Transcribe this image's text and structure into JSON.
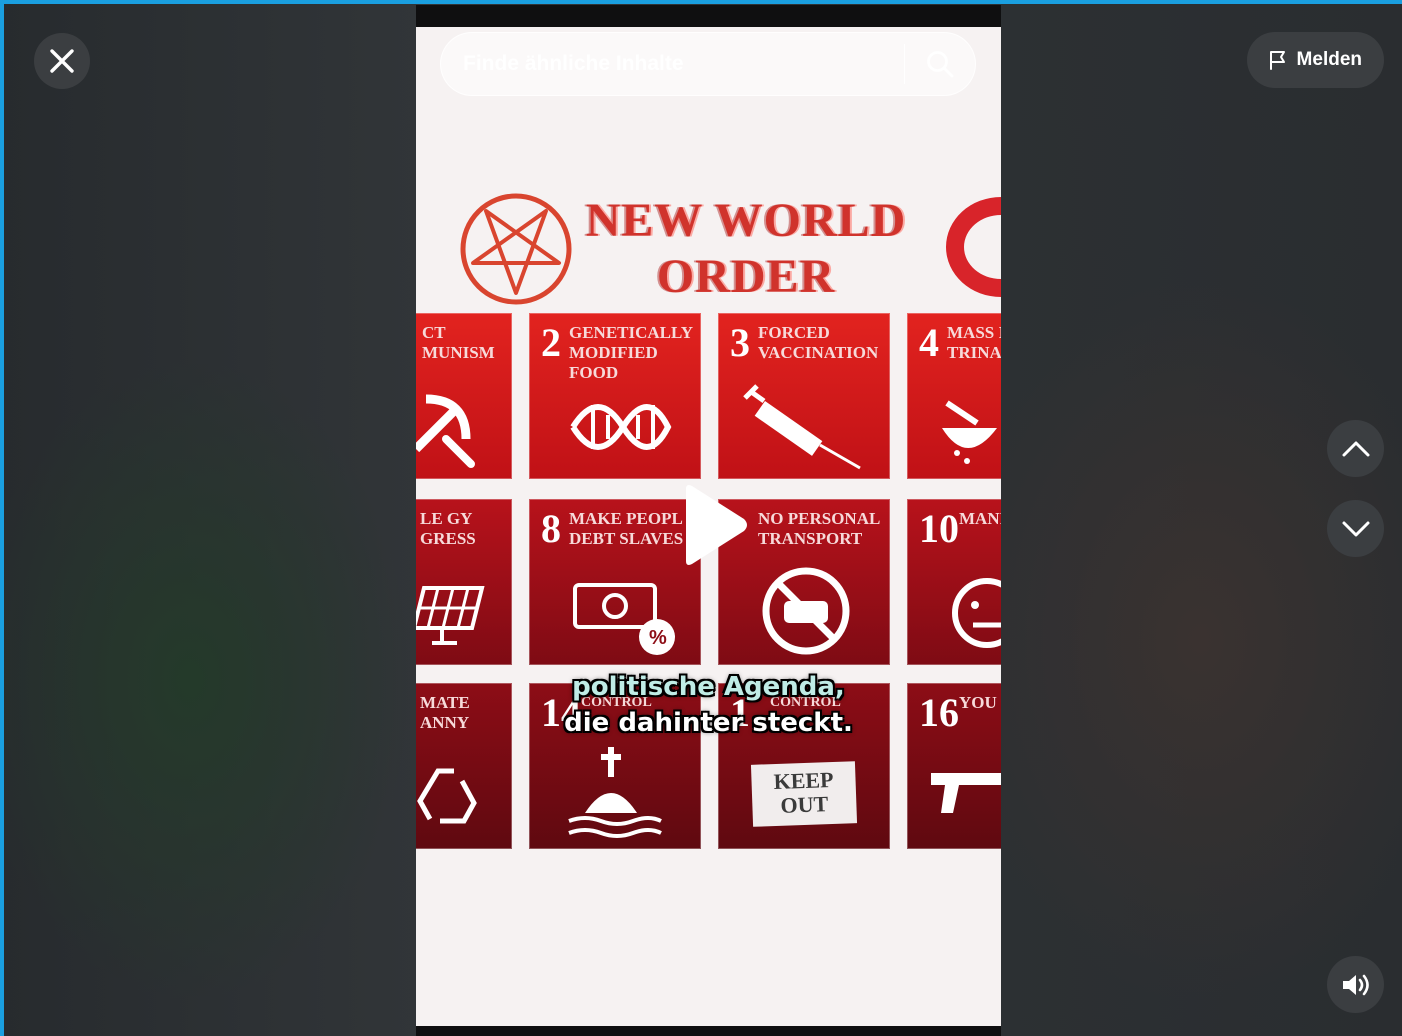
{
  "overlay": {
    "report_label": "Melden",
    "close_icon": "close-icon",
    "report_icon": "flag-icon",
    "prev_icon": "chevron-up-icon",
    "next_icon": "chevron-down-icon",
    "sound_icon": "speaker-icon"
  },
  "search": {
    "placeholder": "Finde ähnliche Inhalte",
    "value": ""
  },
  "video": {
    "poster_title_line1": "NEW WORLD",
    "poster_title_line2": "ORDER",
    "tiles": [
      {
        "num": "",
        "text": "CT MUNISM"
      },
      {
        "num": "2",
        "text": "GENETICALLY MODIFIED FOOD"
      },
      {
        "num": "3",
        "text": "FORCED VACCINATION"
      },
      {
        "num": "4",
        "text": "MASS INDO TRINA"
      },
      {
        "num": "",
        "text": "LE GY GRESS"
      },
      {
        "num": "8",
        "text": "MAKE PEOPL DEBT SLAVES"
      },
      {
        "num": "",
        "text": "NO PERSONAL TRANSPORT"
      },
      {
        "num": "10",
        "text": "MANI CONT"
      },
      {
        "num": "",
        "text": "MATE ANNY"
      },
      {
        "num": "14",
        "text": "CONTROL"
      },
      {
        "num": "1",
        "text": "CONTROL"
      },
      {
        "num": "16",
        "text": "YOU SAY I"
      }
    ],
    "sign_text_line1": "KEEP",
    "sign_text_line2": "OUT",
    "caption_line1": "politische Agenda,",
    "caption_line2": "die dahinter steckt."
  },
  "colors": {
    "accent_border": "#1a9fe0",
    "poster_red": "#d8242a",
    "caption_teal": "#bfece6"
  }
}
